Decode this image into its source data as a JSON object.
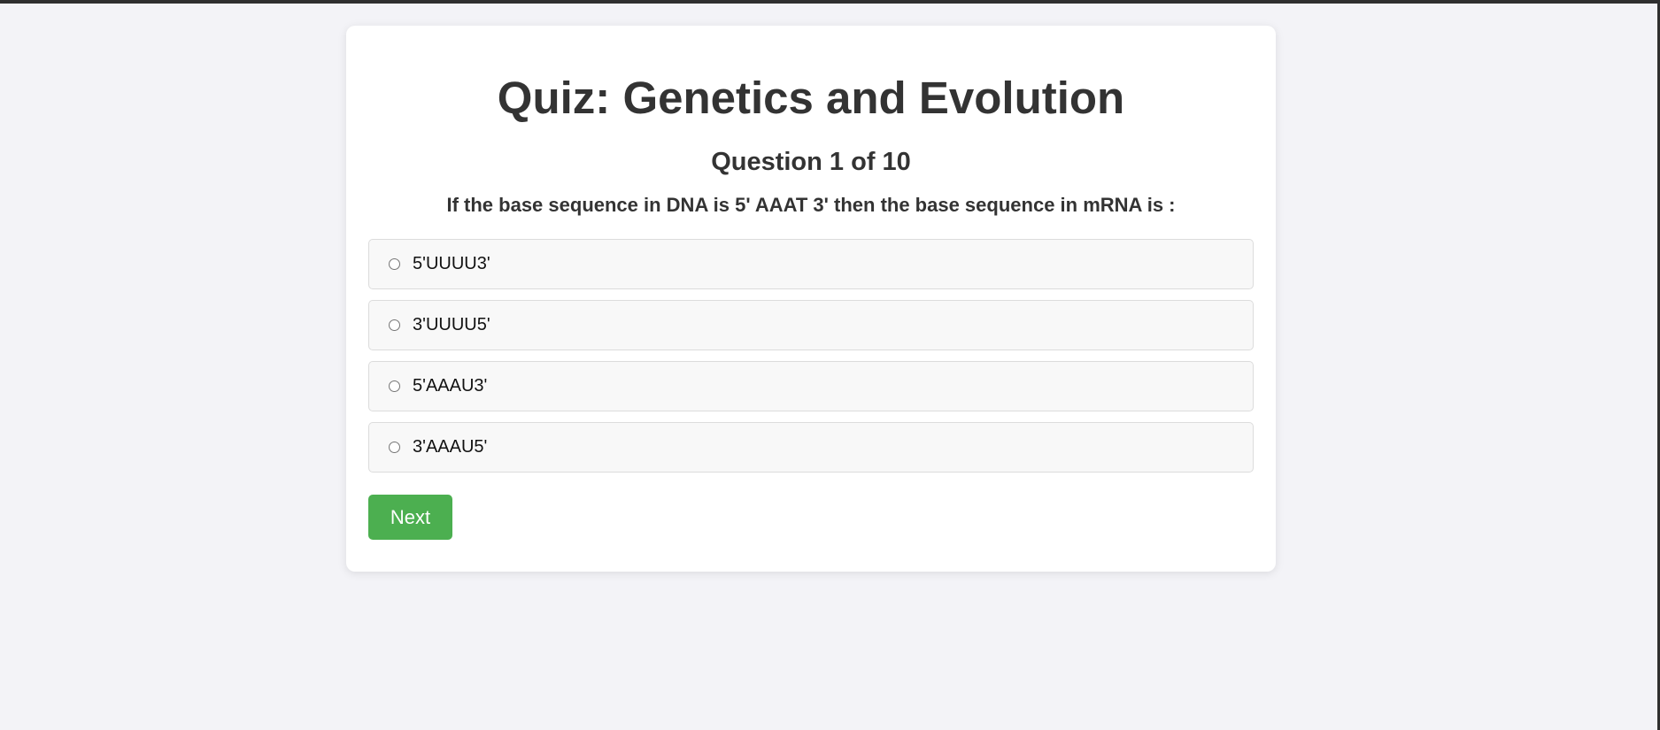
{
  "quiz": {
    "title": "Quiz: Genetics and Evolution",
    "counter": "Question 1 of 10",
    "question": "If the base sequence in DNA is 5' AAAT 3' then the base sequence in mRNA is :",
    "options": [
      {
        "label": "5'UUUU3'",
        "selected": false
      },
      {
        "label": "3'UUUU5'",
        "selected": false
      },
      {
        "label": "5'AAAU3'",
        "selected": false
      },
      {
        "label": "3'AAAU5'",
        "selected": false
      }
    ],
    "next_label": "Next"
  },
  "colors": {
    "page_background": "#f3f3f7",
    "card_background": "#ffffff",
    "accent": "#4caf50",
    "text": "#333333",
    "option_background": "#f8f8f8",
    "option_border": "#dcdcdc"
  }
}
